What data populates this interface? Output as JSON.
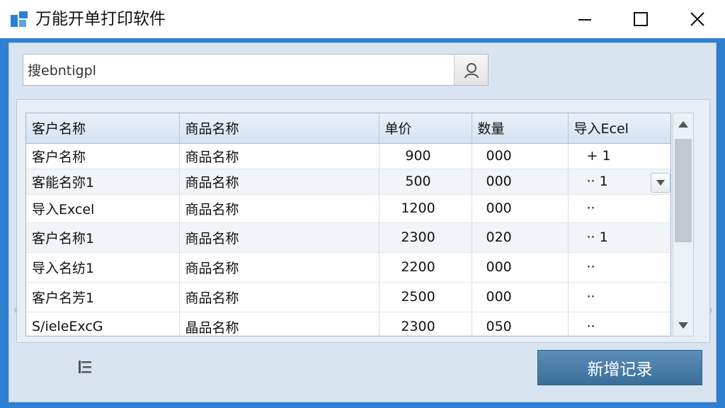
{
  "window": {
    "title": "万能开单打印软件",
    "icons": {
      "app": "app-logo-icon",
      "minimize": "minimize-icon",
      "maximize": "maximize-icon",
      "close": "close-icon"
    }
  },
  "search": {
    "value": "搜ebntigpl",
    "placeholder": "",
    "button_icon": "user-search-icon"
  },
  "table": {
    "columns": [
      "客户名称",
      "商品名称",
      "单价",
      "数量",
      "导入Ecel"
    ],
    "rows": [
      {
        "customer": "客户名称",
        "product": "商品名称",
        "price": "900",
        "qty": "000",
        "import": "+ 1"
      },
      {
        "customer": "客能名弥1",
        "product": "商品名称",
        "price": "500",
        "qty": "000",
        "import": "·· 1"
      },
      {
        "customer": "导入Excel",
        "product": "商品名称",
        "price": "1200",
        "qty": "000",
        "import": "··"
      },
      {
        "customer": "客户名称1",
        "product": "商品名称",
        "price": "2300",
        "qty": "020",
        "import": "·· 1"
      },
      {
        "customer": "导入名纺1",
        "product": "商品名称",
        "price": "2200",
        "qty": "000",
        "import": "··"
      },
      {
        "customer": "客户名芳1",
        "product": "商品名称",
        "price": "2500",
        "qty": "000",
        "import": "··"
      },
      {
        "customer": "S/ieleExcG",
        "product": "晶品名称",
        "price": "2300",
        "qty": "050",
        "import": "··"
      }
    ]
  },
  "footer": {
    "add_button": "新增记录",
    "list_icon": "list-icon"
  },
  "colors": {
    "titlebar": "#ffffff",
    "frame": "#2f7fd0",
    "client": "#d9e4f1",
    "header": "#d4e2f1",
    "button": "#3b6f9b"
  }
}
